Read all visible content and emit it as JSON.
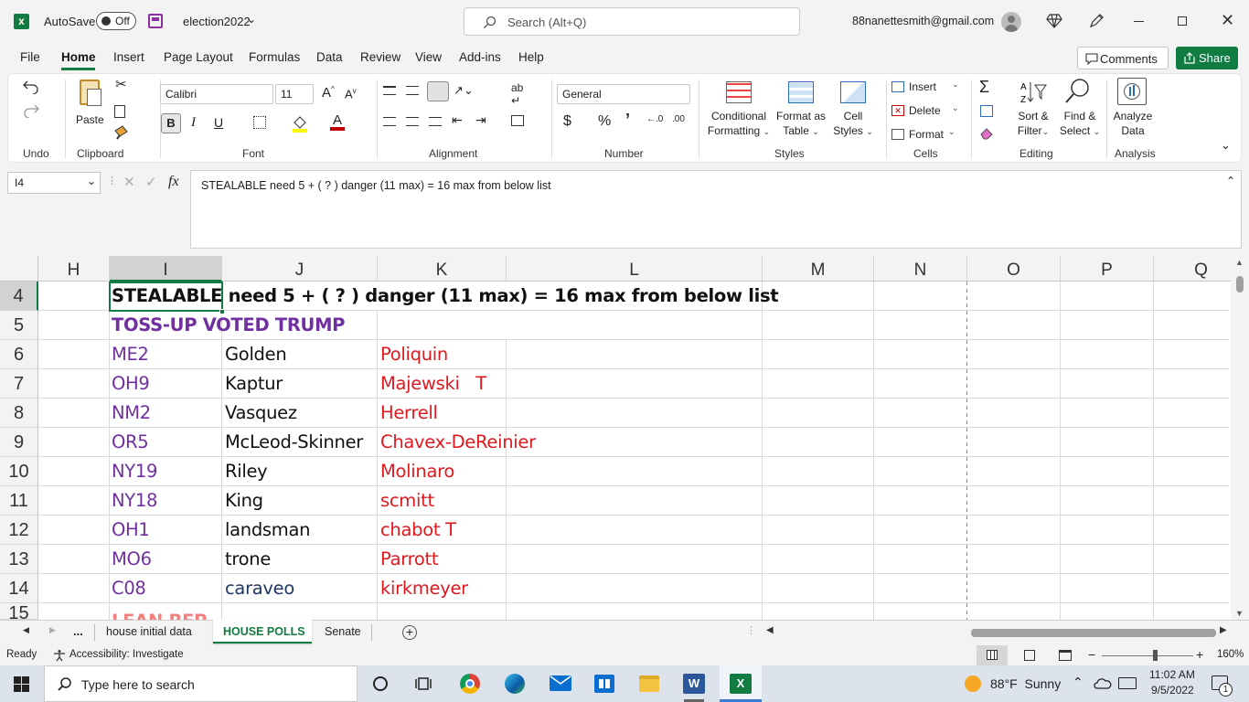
{
  "app": {
    "autosave_label": "AutoSave",
    "autosave_state": "Off",
    "filename": "election2022",
    "search_placeholder": "Search (Alt+Q)",
    "account": "88nanettesmith@gmail.com",
    "brand_color": "#107c41"
  },
  "menu": [
    "File",
    "Home",
    "Insert",
    "Page Layout",
    "Formulas",
    "Data",
    "Review",
    "View",
    "Add-ins",
    "Help"
  ],
  "menu_active": "Home",
  "actions": {
    "comments": "Comments",
    "share": "Share"
  },
  "ribbon": {
    "undo_group": "Undo",
    "clipboard_group": "Clipboard",
    "paste": "Paste",
    "font_group": "Font",
    "font_name": "Calibri",
    "font_size": "11",
    "alignment_group": "Alignment",
    "number_group": "Number",
    "number_format": "General",
    "styles_group": "Styles",
    "conditional": "Conditional",
    "formatting": "Formatting",
    "format_as": "Format as",
    "table": "Table",
    "cell": "Cell",
    "styles": "Styles",
    "cells_group": "Cells",
    "insert": "Insert",
    "delete": "Delete",
    "format": "Format",
    "editing_group": "Editing",
    "sort_filter_1": "Sort &",
    "sort_filter_2": "Filter",
    "find_select_1": "Find &",
    "find_select_2": "Select",
    "analysis_group": "Analysis",
    "analyze_1": "Analyze",
    "analyze_2": "Data"
  },
  "formula_bar": {
    "name_box": "I4",
    "fx": "fx",
    "content": "STEALABLE need 5  + ( ? ) danger (11 max) = 16 max from below list"
  },
  "columns": [
    "H",
    "I",
    "J",
    "K",
    "L",
    "M",
    "N",
    "O",
    "P",
    "Q"
  ],
  "rows": [
    "4",
    "5",
    "6",
    "7",
    "8",
    "9",
    "10",
    "11",
    "12",
    "13",
    "14",
    "15"
  ],
  "cells": {
    "r4": "STEALABLE need 5  + ( ? ) danger (11 max) = 16 max from below list",
    "r5": "TOSS-UP VOTED TRUMP",
    "data": [
      {
        "district": "ME2",
        "dem": "Golden",
        "rep": "Poliquin"
      },
      {
        "district": "OH9",
        "dem": "Kaptur",
        "rep": "Majewski   T"
      },
      {
        "district": "NM2",
        "dem": "Vasquez",
        "rep": "Herrell"
      },
      {
        "district": "OR5",
        "dem": "McLeod-Skinner",
        "rep": "Chavex-DeReinier"
      },
      {
        "district": "NY19",
        "dem": "Riley",
        "rep": "Molinaro"
      },
      {
        "district": "NY18",
        "dem": "King",
        "rep": "scmitt"
      },
      {
        "district": "OH1",
        "dem": "landsman",
        "rep": "chabot T"
      },
      {
        "district": "MO6",
        "dem": "trone",
        "rep": "Parrott"
      },
      {
        "district": "C08",
        "dem": "caraveo",
        "rep": "kirkmeyer"
      }
    ],
    "r15": "LEAN REP"
  },
  "sheets": {
    "more": "...",
    "tabs": [
      "house initial data",
      "HOUSE POLLS",
      "Senate"
    ],
    "active": "HOUSE POLLS"
  },
  "status": {
    "ready": "Ready",
    "accessibility": "Accessibility: Investigate",
    "zoom": "160%"
  },
  "taskbar": {
    "search_placeholder": "Type here to search",
    "weather": "88°F  Sunny",
    "time": "11:02 AM",
    "date": "9/5/2022",
    "notifications": "1"
  }
}
